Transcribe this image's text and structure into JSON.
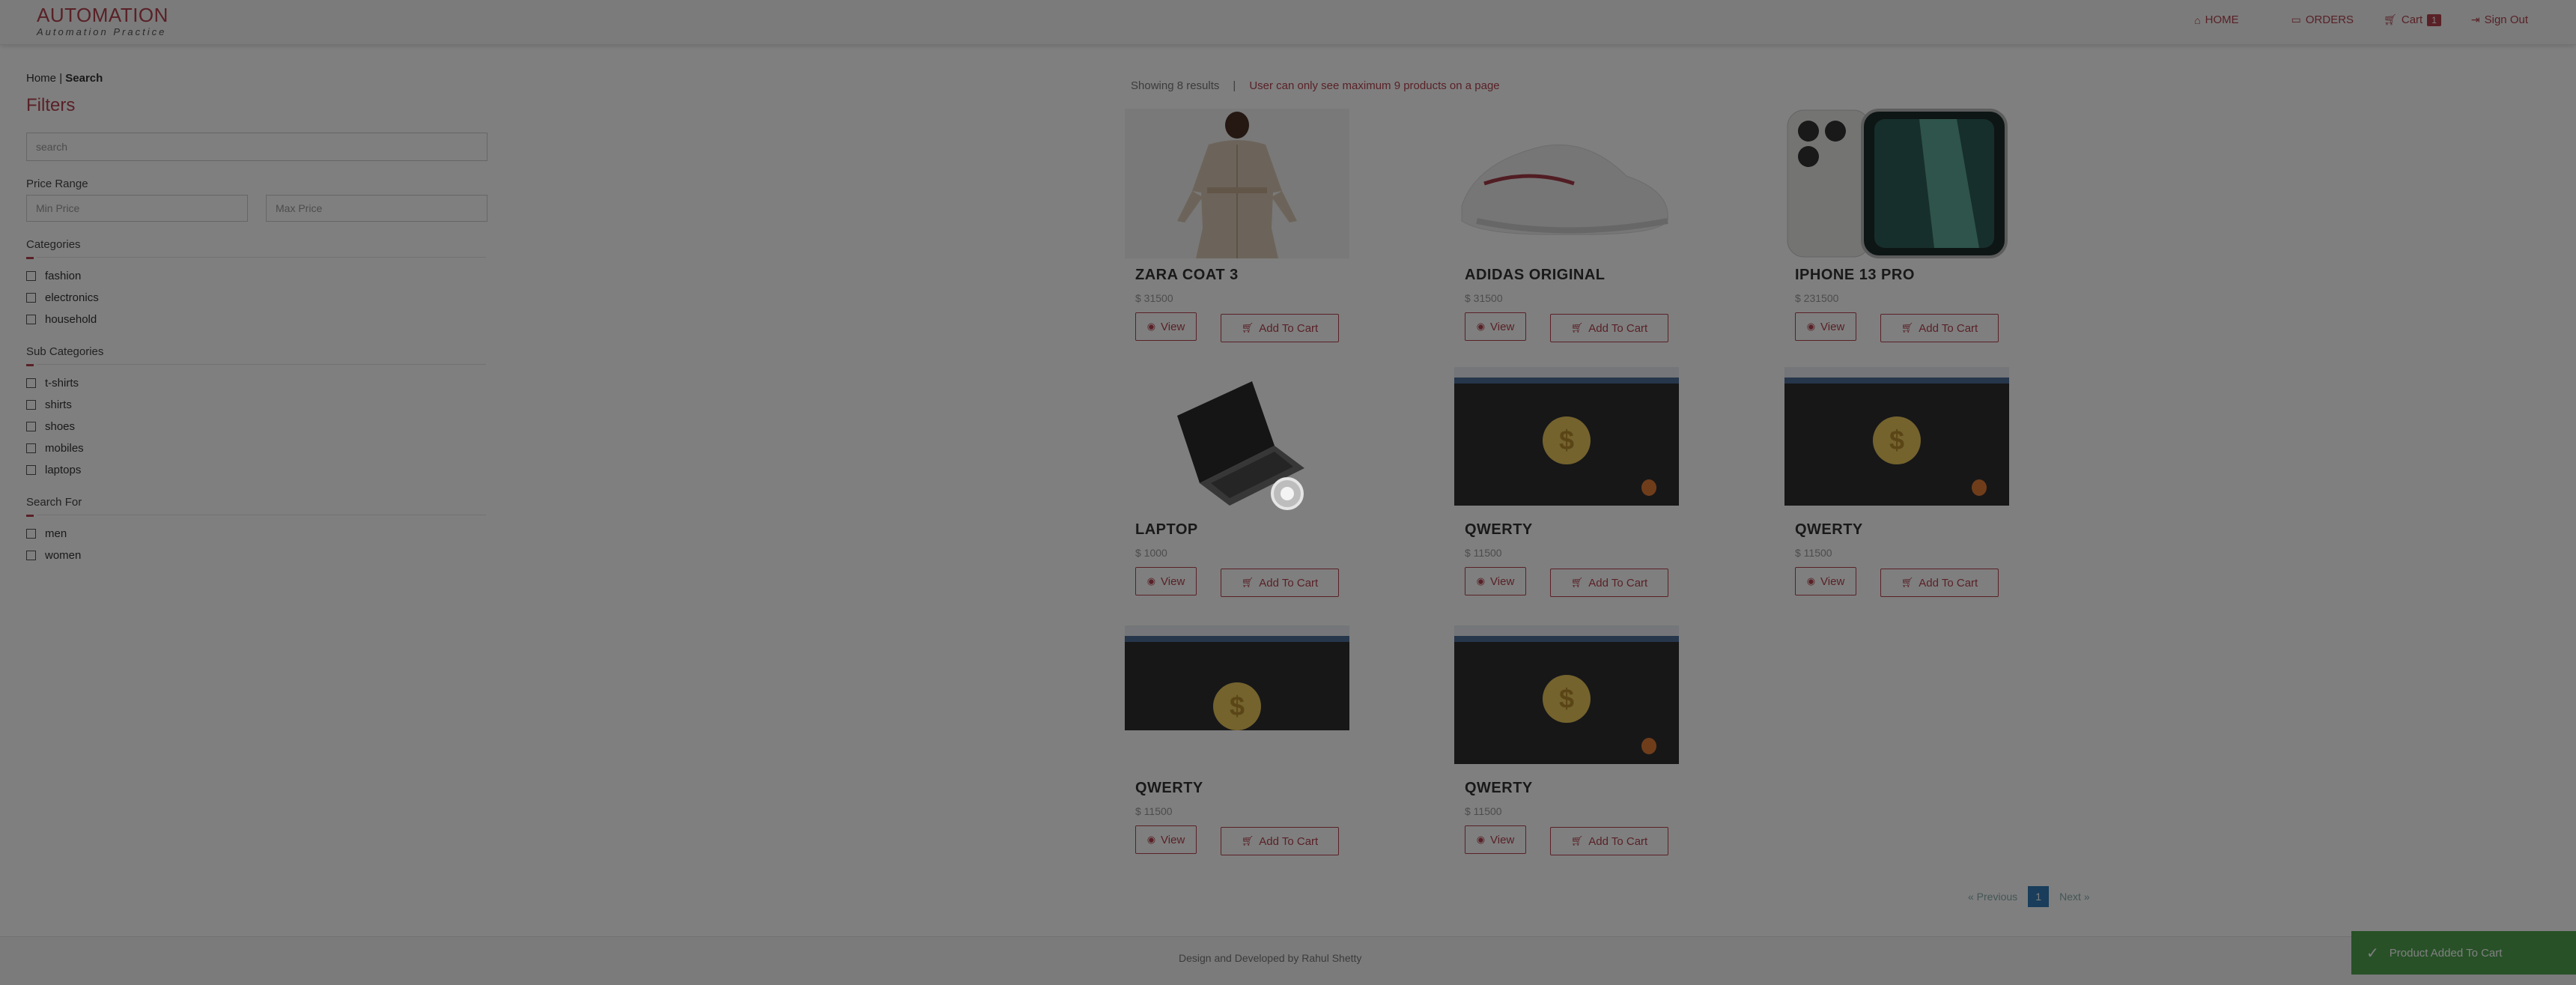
{
  "brand": {
    "title": "AUTOMATION",
    "subtitle": "Automation Practice"
  },
  "nav": {
    "home": "HOME",
    "orders": "ORDERS",
    "cart": "Cart",
    "cart_count": "1",
    "signout": "Sign Out"
  },
  "breadcrumb": {
    "home": "Home",
    "sep": "|",
    "current": "Search"
  },
  "filters": {
    "title": "Filters",
    "search_placeholder": "search",
    "price_range_label": "Price Range",
    "min_placeholder": "Min Price",
    "max_placeholder": "Max Price",
    "categories_label": "Categories",
    "categories": [
      "fashion",
      "electronics",
      "household"
    ],
    "subcategories_label": "Sub Categories",
    "subcategories": [
      "t-shirts",
      "shirts",
      "shoes",
      "mobiles",
      "laptops"
    ],
    "searchfor_label": "Search For",
    "searchfor": [
      "men",
      "women"
    ]
  },
  "results": {
    "showing": "Showing 8 results",
    "sep": "|",
    "warning": "User can only see maximum 9 products on a page"
  },
  "buttons": {
    "view": "View",
    "add_to_cart": "Add To Cart"
  },
  "products": [
    {
      "name": "ZARA COAT 3",
      "price": "$ 31500"
    },
    {
      "name": "ADIDAS ORIGINAL",
      "price": "$ 31500"
    },
    {
      "name": "IPHONE 13 PRO",
      "price": "$ 231500"
    },
    {
      "name": "LAPTOP",
      "price": "$ 1000"
    },
    {
      "name": "QWERTY",
      "price": "$ 11500"
    },
    {
      "name": "QWERTY",
      "price": "$ 11500"
    },
    {
      "name": "QWERTY",
      "price": "$ 11500"
    },
    {
      "name": "QWERTY",
      "price": "$ 11500"
    }
  ],
  "pagination": {
    "previous": "« Previous",
    "page": "1",
    "next": "Next »"
  },
  "footer": {
    "text": "Design and Developed by Rahul Shetty"
  },
  "toast": {
    "text": "Product Added To Cart"
  },
  "colors": {
    "accent": "#b2424f",
    "page_active": "#337ab7",
    "toast": "#51a351"
  },
  "icons": {
    "home": "home-icon",
    "orders": "orders-icon",
    "cart": "cart-icon",
    "signout": "sign-out-icon",
    "view": "eye-icon",
    "add": "cart-icon",
    "toast": "check-icon"
  }
}
